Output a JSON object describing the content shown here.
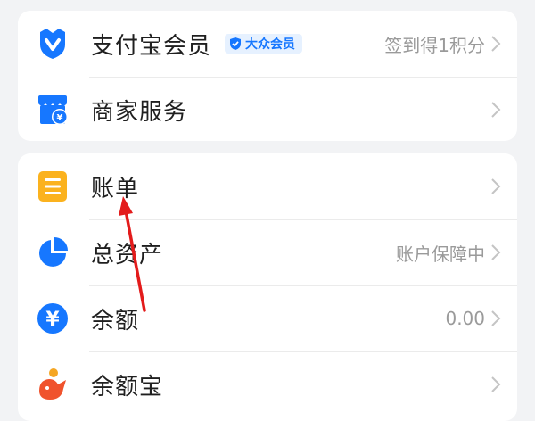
{
  "card1": {
    "items": [
      {
        "label": "支付宝会员",
        "badge": "大众会员",
        "right": "签到得1积分",
        "icon": "alipay-member-icon"
      },
      {
        "label": "商家服务",
        "right": "",
        "icon": "merchant-store-icon"
      }
    ]
  },
  "card2": {
    "items": [
      {
        "label": "账单",
        "right": "",
        "icon": "bill-icon"
      },
      {
        "label": "总资产",
        "right": "账户保障中",
        "icon": "pie-chart-icon"
      },
      {
        "label": "余额",
        "right": "0.00",
        "icon": "yuan-coin-icon"
      },
      {
        "label": "余额宝",
        "right": "",
        "icon": "yuebao-icon"
      }
    ]
  },
  "colors": {
    "primary_blue": "#1677ff",
    "bill_orange": "#fbb21e",
    "arrow_red": "#e31b1b"
  }
}
